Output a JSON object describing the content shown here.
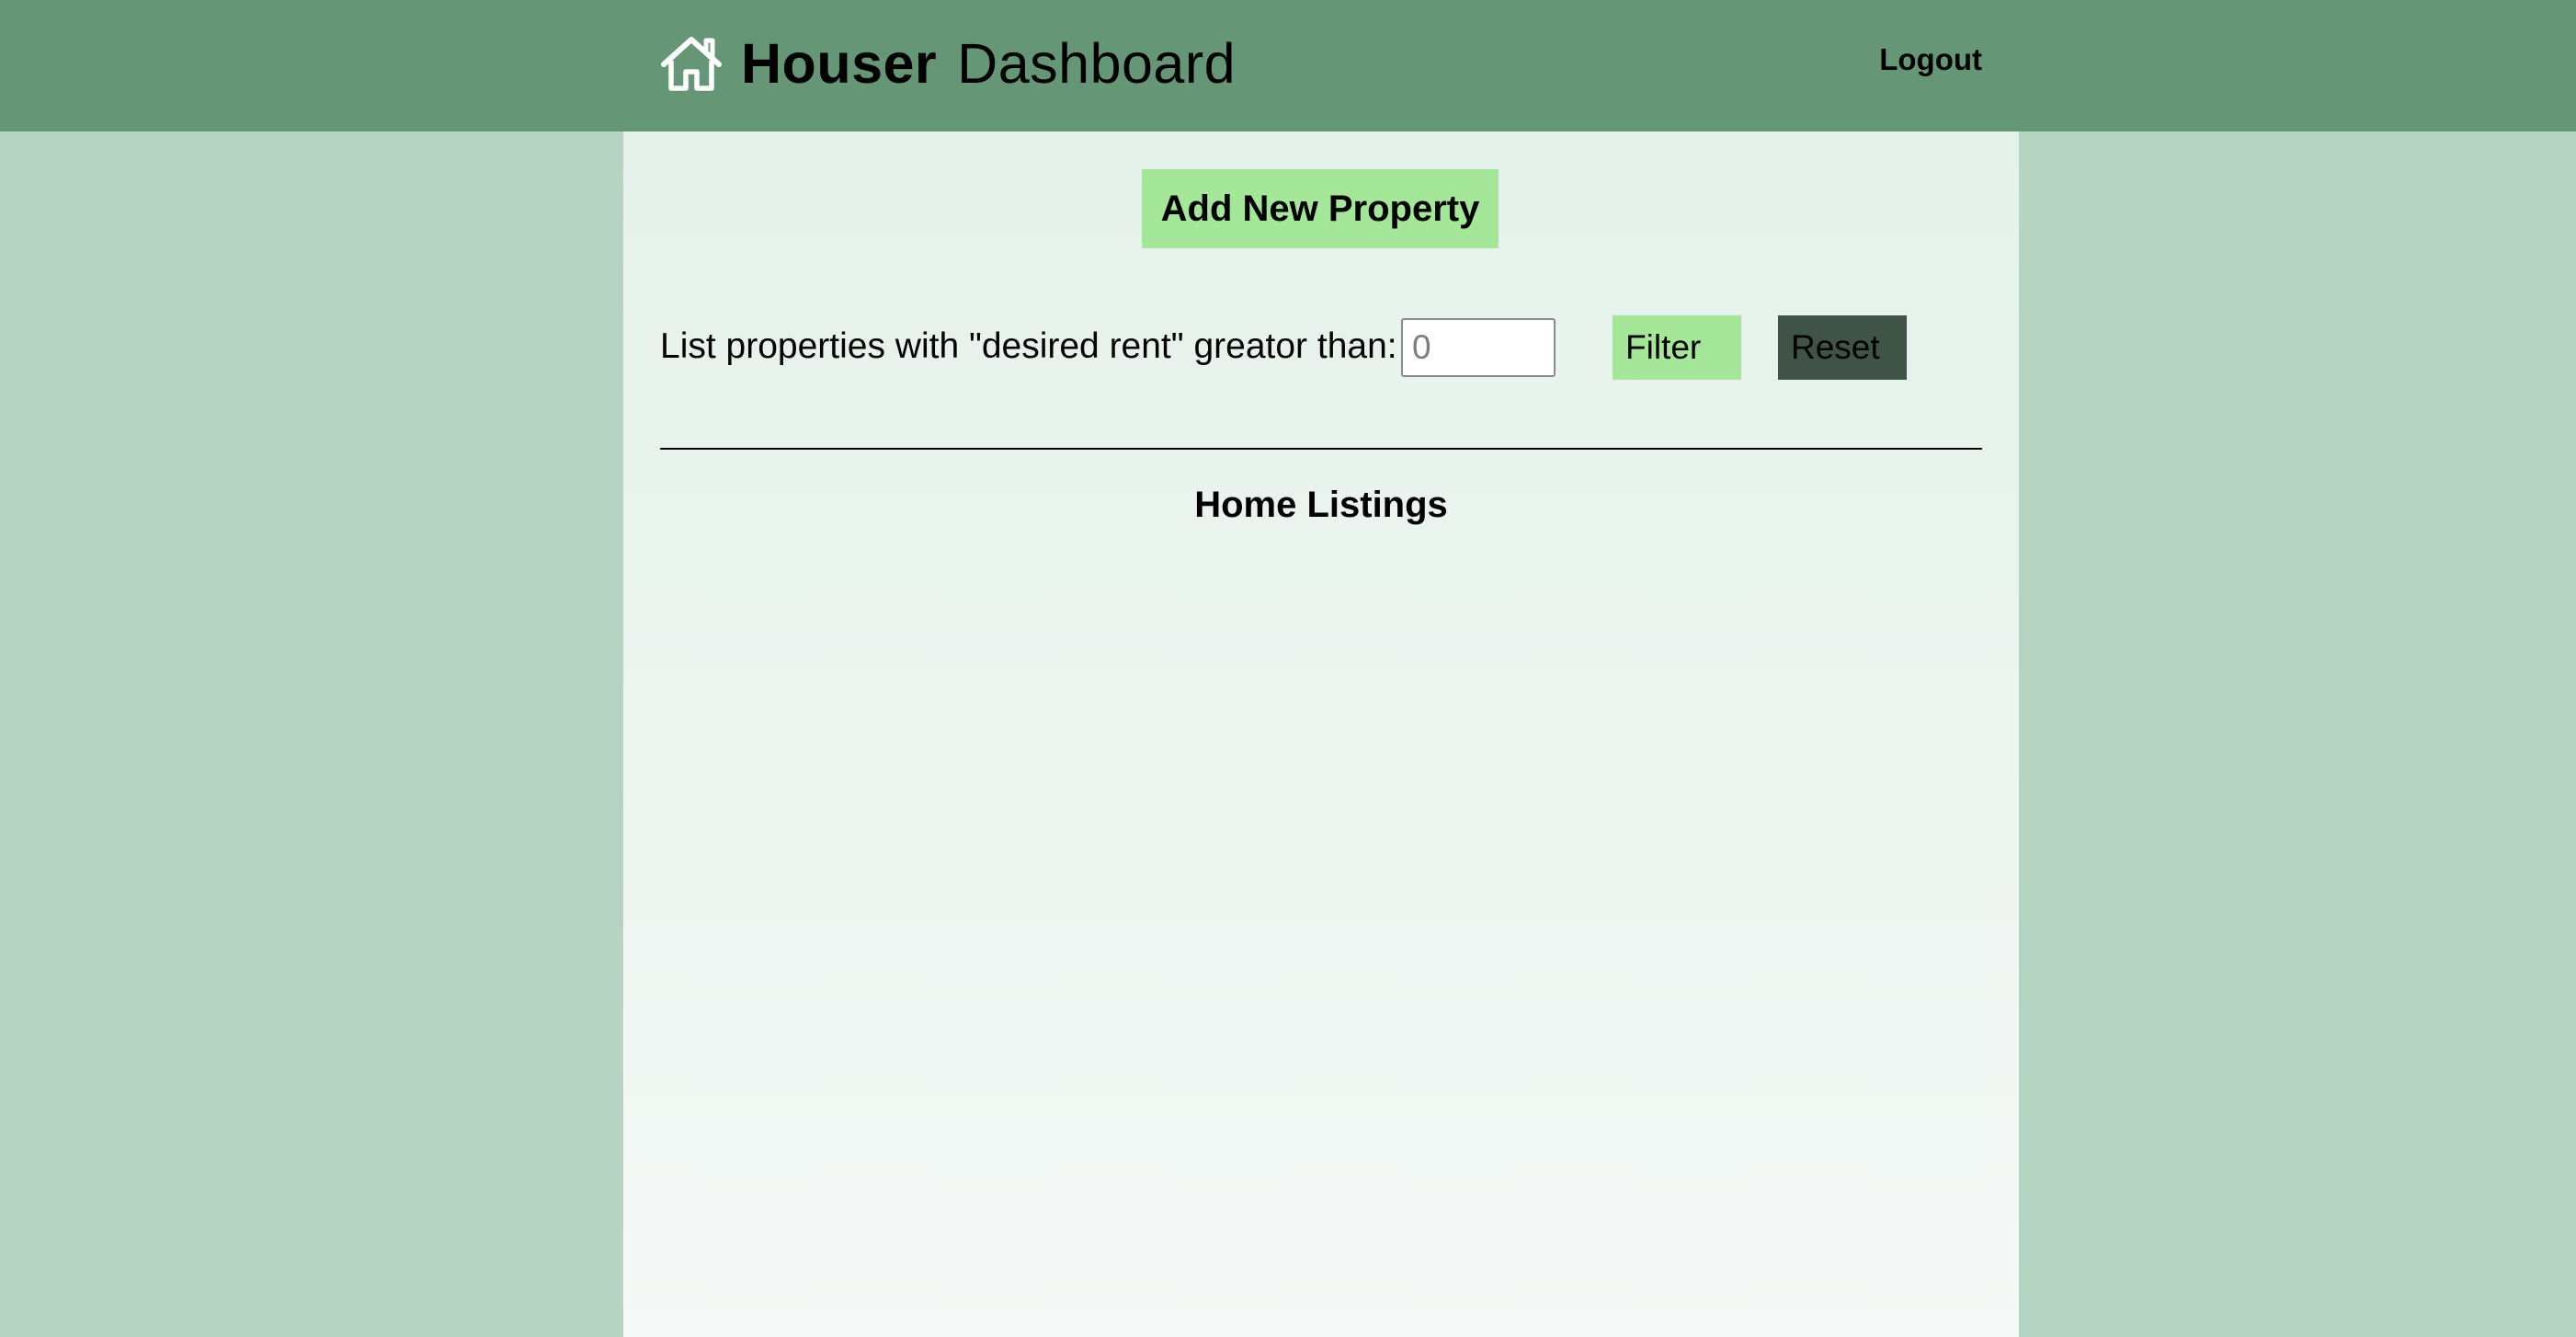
{
  "header": {
    "brand_name": "Houser",
    "brand_suffix": "Dashboard",
    "logo_icon": "home-icon",
    "logout_label": "Logout"
  },
  "main": {
    "add_button_label": "Add New Property",
    "filter": {
      "label": "List properties with \"desired rent\" greator than: $",
      "input_value": "",
      "input_placeholder": "0",
      "filter_button_label": "Filter",
      "reset_button_label": "Reset"
    },
    "listings_title": "Home Listings",
    "listings": []
  },
  "colors": {
    "page_background": "#b5d4c1",
    "header_background": "#659777",
    "accent_button": "#a4e798",
    "reset_button": "#3f5346"
  }
}
